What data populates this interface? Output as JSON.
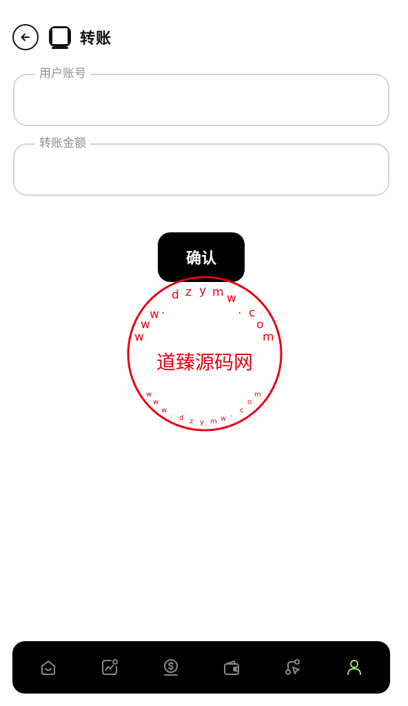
{
  "header": {
    "title": "转账",
    "back_icon": "arrow-left-circle-icon",
    "logo_icon": "app-logo-icon"
  },
  "form": {
    "account_label": "用户账号",
    "account_value": "",
    "amount_label": "转账金额",
    "amount_value": "",
    "confirm_label": "确认"
  },
  "watermark": {
    "center_text": "道臻源码网",
    "ring_text": "www.dzymw.com",
    "color": "#e50012"
  },
  "bottom_nav": {
    "items": [
      {
        "icon": "home-icon",
        "active": false
      },
      {
        "icon": "chart-icon",
        "active": false
      },
      {
        "icon": "coin-icon",
        "active": false
      },
      {
        "icon": "wallet-icon",
        "active": false
      },
      {
        "icon": "route-icon",
        "active": false
      },
      {
        "icon": "user-icon",
        "active": true
      }
    ],
    "inactive_color": "#8a8a8a",
    "active_color": "#9be36a"
  }
}
